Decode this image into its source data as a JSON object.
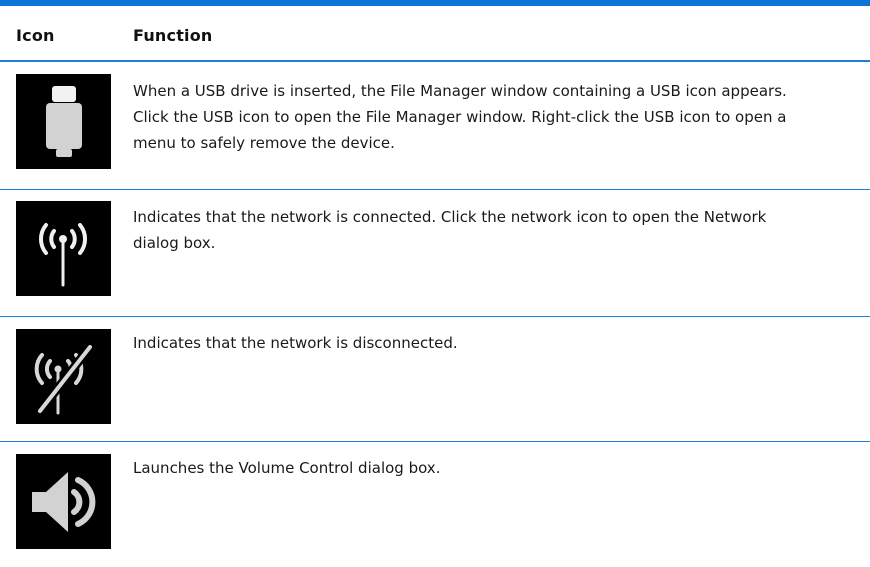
{
  "table": {
    "headers": {
      "icon": "Icon",
      "function": "Function"
    },
    "rows": [
      {
        "icon": "usb-icon",
        "function_lines": [
          "When a USB drive is inserted, the File Manager window containing a USB icon appears.",
          "Click the USB icon to open the File Manager window. Right-click the USB icon to open a",
          "menu to safely remove the device."
        ]
      },
      {
        "icon": "network-connected-icon",
        "function_lines": [
          "Indicates that the network is connected. Click the network icon to open the Network",
          "dialog box."
        ]
      },
      {
        "icon": "network-disconnected-icon",
        "function_lines": [
          "Indicates that the network is disconnected."
        ]
      },
      {
        "icon": "volume-icon",
        "function_lines": [
          "Launches the Volume Control dialog box."
        ]
      }
    ]
  },
  "colors": {
    "rule": "#1f7ed8",
    "top_rule": "#0b74d6",
    "icon_bg": "#000000",
    "icon_fg": "#cfcfcf"
  }
}
